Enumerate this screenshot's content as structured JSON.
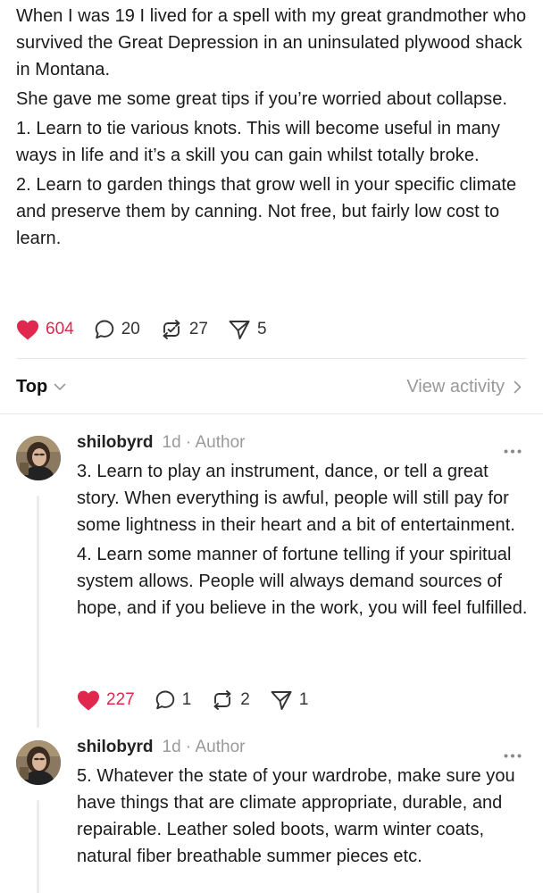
{
  "post": {
    "paragraphs": [
      "When I was 19 I lived for a spell with my great grandmother who survived the Great Depression in an uninsulated plywood shack in Montana.",
      "She gave me some great tips if you’re worried about collapse.",
      "1. Learn to tie various knots. This will become useful in many ways in life and it’s a skill you can gain whilst totally broke.",
      "2. Learn to garden things that grow well in your specific climate and preserve them by canning. Not free, but fairly low cost to learn."
    ],
    "actions": {
      "likes": "604",
      "comments": "20",
      "restacks": "27",
      "shares": "5"
    }
  },
  "sort": {
    "label": "Top",
    "view_activity": "View activity"
  },
  "comments": [
    {
      "user": "shilobyrd",
      "meta": "1d · Author",
      "paragraphs": [
        "3. Learn to play an instrument, dance, or tell a great story. When everything  is awful, people will still pay for some lightness in their heart and a bit of entertainment.",
        "4. Learn some manner of fortune telling if your spiritual system allows. People will always demand sources of hope, and if you believe in the work, you will feel fulfilled."
      ],
      "actions": {
        "likes": "227",
        "comments": "1",
        "restacks": "2",
        "shares": "1"
      }
    },
    {
      "user": "shilobyrd",
      "meta": "1d · Author",
      "paragraphs": [
        "5. Whatever the state of your wardrobe, make sure you have things that are climate appropriate, durable, and repairable. Leather soled boots, warm winter coats, natural fiber breathable summer pieces etc."
      ]
    }
  ],
  "colors": {
    "like": "#e0284e",
    "muted": "#9a9a9a",
    "divider": "#e6e6e6"
  },
  "icons": [
    "heart-icon",
    "comment-icon",
    "restack-icon",
    "share-icon",
    "chevron-down-icon",
    "chevron-right-icon",
    "more-icon"
  ]
}
